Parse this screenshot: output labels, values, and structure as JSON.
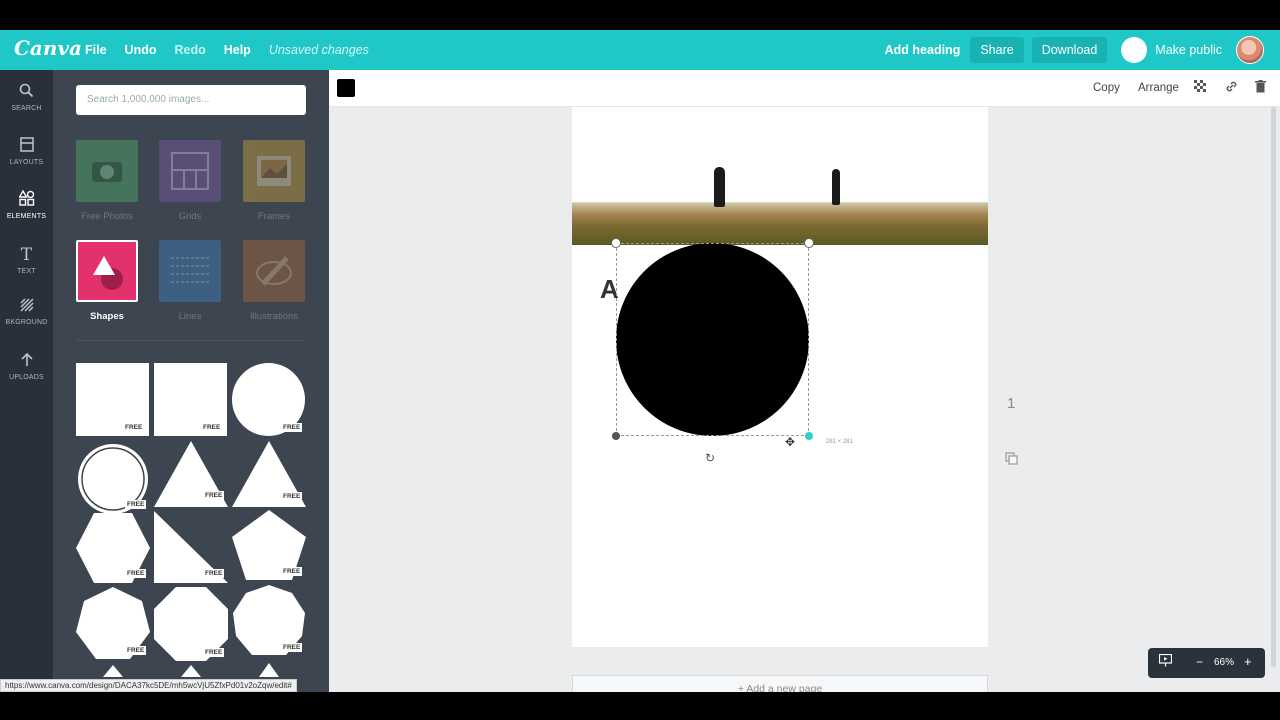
{
  "app": {
    "logo": "Canva",
    "menu": {
      "file": "File",
      "undo": "Undo",
      "redo": "Redo",
      "help": "Help",
      "status": "Unsaved changes"
    },
    "actions": {
      "add_heading": "Add heading",
      "share": "Share",
      "download": "Download",
      "make_public": "Make public"
    }
  },
  "sidebar": {
    "items": [
      {
        "label": "SEARCH",
        "icon": "search-icon"
      },
      {
        "label": "LAYOUTS",
        "icon": "layouts-icon"
      },
      {
        "label": "ELEMENTS",
        "icon": "elements-icon"
      },
      {
        "label": "TEXT",
        "icon": "text-icon"
      },
      {
        "label": "BKGROUND",
        "icon": "background-icon"
      },
      {
        "label": "UPLOADS",
        "icon": "upload-icon"
      }
    ],
    "active": "ELEMENTS"
  },
  "panel": {
    "search_placeholder": "Search 1,000,000 images...",
    "categories": [
      {
        "label": "Free Photos"
      },
      {
        "label": "Grids"
      },
      {
        "label": "Frames"
      },
      {
        "label": "Shapes"
      },
      {
        "label": "Lines"
      },
      {
        "label": "Illustrations"
      }
    ],
    "free_badge": "FREE"
  },
  "editor": {
    "toolbar": {
      "copy": "Copy",
      "arrange": "Arrange"
    },
    "selection_size": "281 × 281",
    "page_number": "1",
    "add_page": "+ Add a new page",
    "zoom": "66%",
    "zoom_minus": "−",
    "zoom_plus": "+"
  },
  "status_url": "https://www.canva.com/design/DACA37kc5DE/mh5wcVjU5ZfxPd01v2oZqw/edit#",
  "colors": {
    "brand": "#1fc7c7",
    "sidebar": "#293039",
    "panel": "#3c4550",
    "shape_accent": "#e3316e"
  }
}
